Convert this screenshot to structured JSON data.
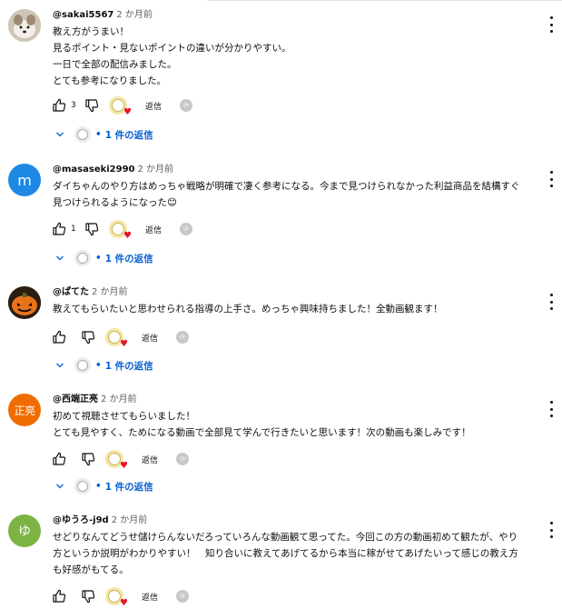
{
  "ui": {
    "reply_label": "返信",
    "replies_label": "1 件の返信",
    "bullet": "•",
    "accent": "#065fd4"
  },
  "comments": [
    {
      "author": "@sakai5567",
      "time": "2 か月前",
      "avatar": "photo",
      "lines": [
        "教え方がうまい！",
        "見るポイント・見ないポイントの違いが分かりやすい。",
        "一日で全部の配信みました。",
        "とても参考になりました。"
      ],
      "likes": "3"
    },
    {
      "author": "@masaseki2990",
      "time": "2 か月前",
      "avatar_letter": "m",
      "lines": [
        "ダイちゃんのやり方はめっちゃ戦略が明確で凄く参考になる。今まで見つけられなかった利益商品を結構すぐ見つけられるようになった😊"
      ],
      "likes": "1"
    },
    {
      "author": "@ぱてた",
      "time": "2 か月前",
      "avatar": "photo",
      "lines": [
        "教えてもらいたいと思わせられる指導の上手さ。めっちゃ興味持ちました！全動画観ます！"
      ],
      "likes": ""
    },
    {
      "author": "@西端正亮",
      "time": "2 か月前",
      "avatar_letter": "正亮",
      "lines": [
        "初めて視聴させてもらいました！",
        "とても見やすく、ためになる動画で全部見て学んで行きたいと思います！次の動画も楽しみです！"
      ],
      "likes": ""
    },
    {
      "author": "@ゆうろ-j9d",
      "time": "2 か月前",
      "avatar_letter": "ゆ",
      "lines": [
        "せどりなんてどうせ儲けらんないだろっていろんな動画観て思ってた。今回この方の動画初めて観たが、やり方というか説明がわかりやすい！　知り合いに教えてあげてるから本当に稼がせてあげたいって感じの教え方も好感がもてる。"
      ],
      "likes": ""
    }
  ]
}
